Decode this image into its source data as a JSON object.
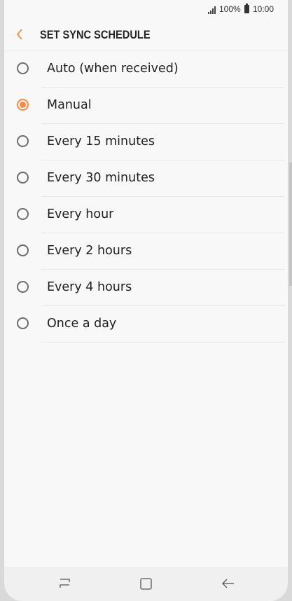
{
  "status": {
    "battery": "100%",
    "time": "10:00"
  },
  "header": {
    "title": "SET SYNC SCHEDULE"
  },
  "accent_color": "#f68c43",
  "options": [
    {
      "label": "Auto (when received)",
      "selected": false
    },
    {
      "label": "Manual",
      "selected": true
    },
    {
      "label": "Every 15 minutes",
      "selected": false
    },
    {
      "label": "Every 30 minutes",
      "selected": false
    },
    {
      "label": "Every hour",
      "selected": false
    },
    {
      "label": "Every 2 hours",
      "selected": false
    },
    {
      "label": "Every 4 hours",
      "selected": false
    },
    {
      "label": "Once a day",
      "selected": false
    }
  ],
  "nav": {
    "icons": [
      "recent-apps-icon",
      "home-icon",
      "back-icon"
    ]
  }
}
